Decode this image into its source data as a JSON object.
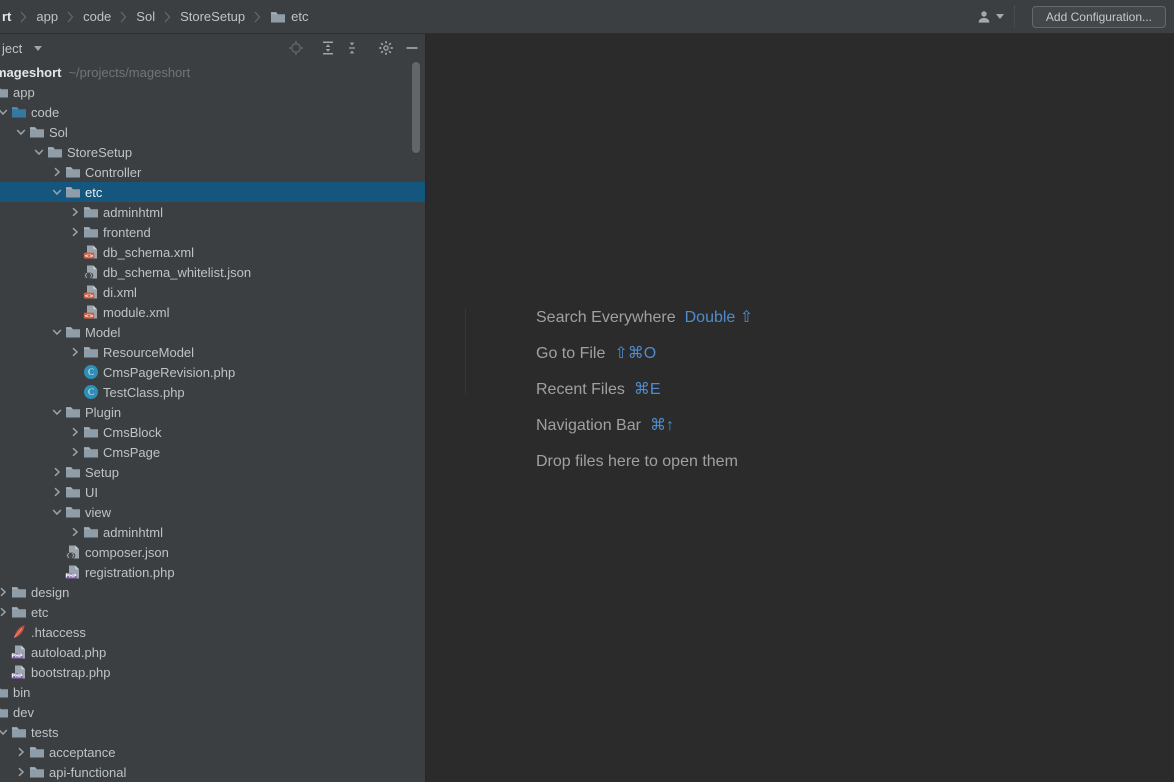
{
  "colors": {
    "bg_editor": "#2b2b2b",
    "bg_panel": "#3c3f41",
    "selection": "#14567d",
    "accent_blue": "#4e8cd0",
    "text": "#bdc3c7",
    "text_bright": "#e3e6e8",
    "text_dim": "#6f7579",
    "folder": "#8e9da8",
    "folder_flap": "#a3b0ba",
    "folder_code": "#3579a0",
    "folder_code_flap": "#5190b4",
    "xml_badge": "#ce5f43",
    "php_badge": "#7f61a7",
    "class_circle": "#2e8fb7",
    "feather": "#c4513b",
    "icon_gray": "#9fa5a9"
  },
  "top_bar": {
    "breadcrumbs": [
      {
        "label": "rt",
        "bold": true,
        "icon": null
      },
      {
        "label": "app",
        "bold": false,
        "icon": null
      },
      {
        "label": "code",
        "bold": false,
        "icon": null
      },
      {
        "label": "Sol",
        "bold": false,
        "icon": null
      },
      {
        "label": "StoreSetup",
        "bold": false,
        "icon": null
      },
      {
        "label": "etc",
        "bold": false,
        "icon": "folder"
      }
    ],
    "user_icon": "user-icon",
    "add_configuration_label": "Add Configuration..."
  },
  "project_panel": {
    "header": {
      "title": "ject",
      "icons": [
        "locate-icon",
        "expand-all-icon",
        "collapse-all-icon",
        "settings-gear-icon",
        "hide-icon"
      ]
    },
    "root_path": "~/projects/mageshort",
    "rows": [
      {
        "label": "mageshort",
        "level": 0,
        "chevron": "down",
        "icon": "folder",
        "selected": false,
        "bold": true,
        "extra": "~/projects/mageshort"
      },
      {
        "label": "app",
        "level": 1,
        "chevron": "down",
        "icon": "folder",
        "selected": false
      },
      {
        "label": "code",
        "level": 2,
        "chevron": "down",
        "icon": "folder-code",
        "selected": false
      },
      {
        "label": "Sol",
        "level": 3,
        "chevron": "down",
        "icon": "folder",
        "selected": false
      },
      {
        "label": "StoreSetup",
        "level": 4,
        "chevron": "down",
        "icon": "folder",
        "selected": false
      },
      {
        "label": "Controller",
        "level": 5,
        "chevron": "right",
        "icon": "folder",
        "selected": false
      },
      {
        "label": "etc",
        "level": 5,
        "chevron": "down",
        "icon": "folder",
        "selected": true
      },
      {
        "label": "adminhtml",
        "level": 6,
        "chevron": "right",
        "icon": "folder",
        "selected": false
      },
      {
        "label": "frontend",
        "level": 6,
        "chevron": "right",
        "icon": "folder",
        "selected": false
      },
      {
        "label": "db_schema.xml",
        "level": 6,
        "chevron": null,
        "icon": "xml",
        "selected": false
      },
      {
        "label": "db_schema_whitelist.json",
        "level": 6,
        "chevron": null,
        "icon": "json",
        "selected": false
      },
      {
        "label": "di.xml",
        "level": 6,
        "chevron": null,
        "icon": "xml",
        "selected": false
      },
      {
        "label": "module.xml",
        "level": 6,
        "chevron": null,
        "icon": "xml",
        "selected": false
      },
      {
        "label": "Model",
        "level": 5,
        "chevron": "down",
        "icon": "folder",
        "selected": false
      },
      {
        "label": "ResourceModel",
        "level": 6,
        "chevron": "right",
        "icon": "folder",
        "selected": false
      },
      {
        "label": "CmsPageRevision.php",
        "level": 6,
        "chevron": null,
        "icon": "php-class",
        "selected": false
      },
      {
        "label": "TestClass.php",
        "level": 6,
        "chevron": null,
        "icon": "php-class",
        "selected": false
      },
      {
        "label": "Plugin",
        "level": 5,
        "chevron": "down",
        "icon": "folder",
        "selected": false
      },
      {
        "label": "CmsBlock",
        "level": 6,
        "chevron": "right",
        "icon": "folder",
        "selected": false
      },
      {
        "label": "CmsPage",
        "level": 6,
        "chevron": "right",
        "icon": "folder",
        "selected": false
      },
      {
        "label": "Setup",
        "level": 5,
        "chevron": "right",
        "icon": "folder",
        "selected": false
      },
      {
        "label": "UI",
        "level": 5,
        "chevron": "right",
        "icon": "folder",
        "selected": false
      },
      {
        "label": "view",
        "level": 5,
        "chevron": "down",
        "icon": "folder",
        "selected": false
      },
      {
        "label": "adminhtml",
        "level": 6,
        "chevron": "right",
        "icon": "folder",
        "selected": false
      },
      {
        "label": "composer.json",
        "level": 5,
        "chevron": null,
        "icon": "json",
        "selected": false
      },
      {
        "label": "registration.php",
        "level": 5,
        "chevron": null,
        "icon": "php-file",
        "selected": false
      },
      {
        "label": "design",
        "level": 2,
        "chevron": "right",
        "icon": "folder",
        "selected": false
      },
      {
        "label": "etc",
        "level": 2,
        "chevron": "right",
        "icon": "folder",
        "selected": false
      },
      {
        "label": ".htaccess",
        "level": 2,
        "chevron": null,
        "icon": "htaccess",
        "selected": false
      },
      {
        "label": "autoload.php",
        "level": 2,
        "chevron": null,
        "icon": "php-file",
        "selected": false
      },
      {
        "label": "bootstrap.php",
        "level": 2,
        "chevron": null,
        "icon": "php-file",
        "selected": false
      },
      {
        "label": "bin",
        "level": 1,
        "chevron": "right",
        "icon": "folder",
        "selected": false
      },
      {
        "label": "dev",
        "level": 1,
        "chevron": "down",
        "icon": "folder",
        "selected": false
      },
      {
        "label": "tests",
        "level": 2,
        "chevron": "down",
        "icon": "folder",
        "selected": false
      },
      {
        "label": "acceptance",
        "level": 3,
        "chevron": "right",
        "icon": "folder",
        "selected": false
      },
      {
        "label": "api-functional",
        "level": 3,
        "chevron": "right",
        "icon": "folder",
        "selected": false
      }
    ]
  },
  "editor": {
    "shortcuts": [
      {
        "label": "Search Everywhere",
        "keys": "Double ⇧"
      },
      {
        "label": "Go to File",
        "keys": "⇧⌘O"
      },
      {
        "label": "Recent Files",
        "keys": "⌘E"
      },
      {
        "label": "Navigation Bar",
        "keys": "⌘↑"
      }
    ],
    "drop_hint": "Drop files here to open them"
  }
}
